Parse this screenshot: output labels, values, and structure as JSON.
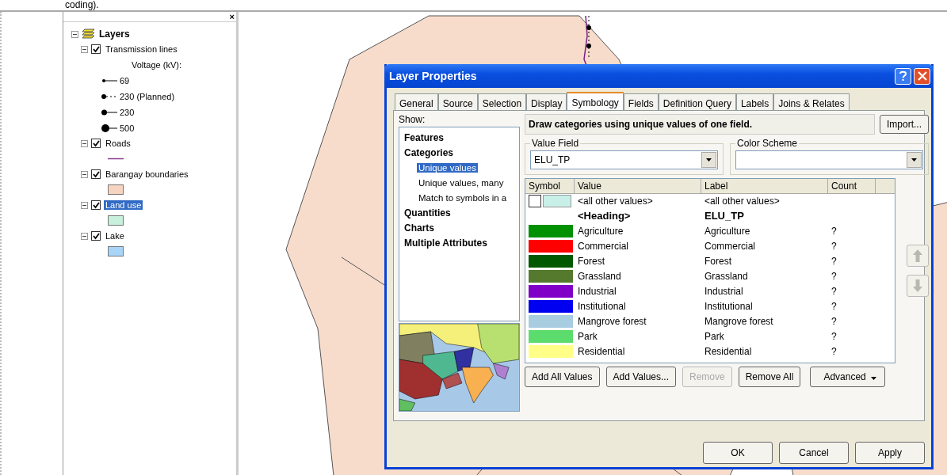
{
  "doc_text": "coding).",
  "toc": {
    "close": "×",
    "root": "Layers",
    "layers": [
      {
        "name": "Transmission lines",
        "checked": true,
        "expanded": true,
        "selected": false,
        "legend_title": "Voltage (kV):",
        "legend": [
          {
            "kind": "small-dot",
            "label": "69"
          },
          {
            "kind": "dashed",
            "label": "230 (Planned)"
          },
          {
            "kind": "medium-dot",
            "label": "230"
          },
          {
            "kind": "large-dot",
            "label": "500"
          }
        ]
      },
      {
        "name": "Roads",
        "checked": true,
        "expanded": true,
        "selected": false,
        "legend": [
          {
            "kind": "line",
            "color": "#8b3a8b"
          }
        ]
      },
      {
        "name": "Barangay boundaries",
        "checked": true,
        "expanded": true,
        "selected": false,
        "legend": [
          {
            "kind": "patch",
            "color": "#f7d4c0"
          }
        ]
      },
      {
        "name": "Land use",
        "checked": true,
        "expanded": true,
        "selected": true,
        "legend": [
          {
            "kind": "patch",
            "color": "#c8f0dc"
          }
        ]
      },
      {
        "name": "Lake",
        "checked": true,
        "expanded": true,
        "selected": false,
        "legend": [
          {
            "kind": "patch",
            "color": "#a8d4f8"
          }
        ]
      }
    ]
  },
  "dialog": {
    "title": "Layer Properties",
    "tabs": [
      {
        "label": "General",
        "selected": false
      },
      {
        "label": "Source",
        "selected": false
      },
      {
        "label": "Selection",
        "selected": false
      },
      {
        "label": "Display",
        "selected": false
      },
      {
        "label": "Symbology",
        "selected": true
      },
      {
        "label": "Fields",
        "selected": false
      },
      {
        "label": "Definition Query",
        "selected": false
      },
      {
        "label": "Labels",
        "selected": false
      },
      {
        "label": "Joins & Relates",
        "selected": false
      }
    ],
    "show_label": "Show:",
    "show_tree": [
      {
        "label": "Features",
        "selected": false
      },
      {
        "label": "Categories",
        "selected": false,
        "children": [
          {
            "label": "Unique values",
            "selected": true
          },
          {
            "label": "Unique values, many",
            "selected": false
          },
          {
            "label": "Match to symbols in a",
            "selected": false
          }
        ]
      },
      {
        "label": "Quantities",
        "selected": false
      },
      {
        "label": "Charts",
        "selected": false
      },
      {
        "label": "Multiple Attributes",
        "selected": false
      }
    ],
    "description": "Draw categories using unique values of one field.",
    "import_button": "Import...",
    "value_field": {
      "legend": "Value Field",
      "value": "ELU_TP"
    },
    "color_scheme": {
      "legend": "Color Scheme"
    },
    "table": {
      "columns": [
        "Symbol",
        "Value",
        "Label",
        "Count"
      ],
      "rows": [
        {
          "kind": "other",
          "color": "#c8f0e8",
          "value": "<all other values>",
          "label": "<all other values>"
        },
        {
          "kind": "heading",
          "value": "<Heading>",
          "label": "ELU_TP"
        },
        {
          "kind": "category",
          "color": "#009000",
          "value": "Agriculture",
          "label": "Agriculture",
          "count": "?"
        },
        {
          "kind": "category",
          "color": "#ff0000",
          "value": "Commercial",
          "label": "Commercial",
          "count": "?"
        },
        {
          "kind": "category",
          "color": "#005800",
          "value": "Forest",
          "label": "Forest",
          "count": "?"
        },
        {
          "kind": "category",
          "color": "#557a2e",
          "value": "Grassland",
          "label": "Grassland",
          "count": "?"
        },
        {
          "kind": "category",
          "color": "#8000c8",
          "value": "Industrial",
          "label": "Industrial",
          "count": "?"
        },
        {
          "kind": "category",
          "color": "#0000f0",
          "value": "Institutional",
          "label": "Institutional",
          "count": "?"
        },
        {
          "kind": "category",
          "color": "#a8cce0",
          "value": "Mangrove forest",
          "label": "Mangrove forest",
          "count": "?"
        },
        {
          "kind": "category",
          "color": "#5cdc6c",
          "value": "Park",
          "label": "Park",
          "count": "?"
        },
        {
          "kind": "category",
          "color": "#ffff88",
          "value": "Residential",
          "label": "Residential",
          "count": "?"
        }
      ]
    },
    "table_buttons": [
      {
        "label": "Add All Values",
        "disabled": false
      },
      {
        "label": "Add Values...",
        "disabled": false
      },
      {
        "label": "Remove",
        "disabled": true
      },
      {
        "label": "Remove All",
        "disabled": false
      },
      {
        "label": "Advanced",
        "disabled": false,
        "kind": "menu"
      }
    ],
    "footer_buttons": [
      "OK",
      "Cancel",
      "Apply"
    ]
  }
}
